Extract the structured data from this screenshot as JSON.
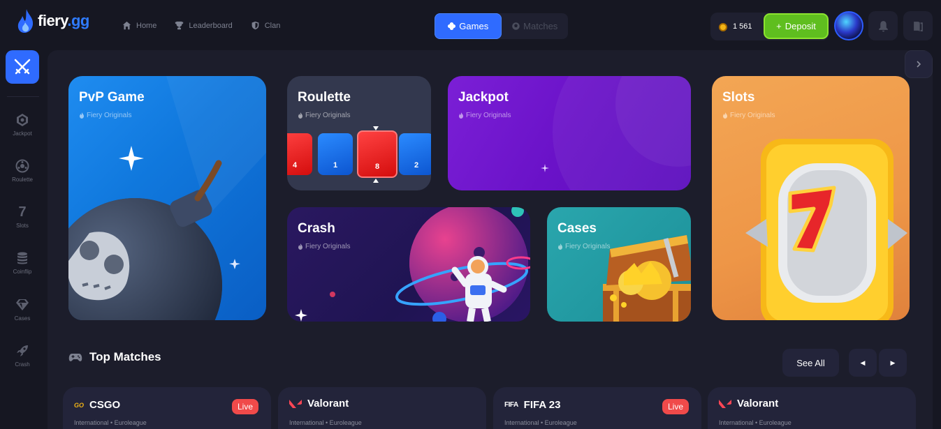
{
  "brand": {
    "name": "fiery",
    "tld": ".gg"
  },
  "nav": [
    {
      "label": "Home",
      "icon": "home-icon"
    },
    {
      "label": "Leaderboard",
      "icon": "trophy-icon"
    },
    {
      "label": "Clan",
      "icon": "shield-icon"
    }
  ],
  "switcher": {
    "games": "Games",
    "matches": "Matches",
    "active": "games"
  },
  "balance": {
    "value": "1 561",
    "currency_icon": "coin-icon"
  },
  "deposit_label": "Deposit",
  "colors": {
    "accent": "#2f6bff",
    "deposit": "#5fbe1f",
    "live": "#f04a4a"
  },
  "sidebar": [
    {
      "label": "Jackpot",
      "icon": "jackpot-icon"
    },
    {
      "label": "Roulette",
      "icon": "roulette-icon"
    },
    {
      "label": "Slots",
      "icon": "seven-icon"
    },
    {
      "label": "Coinflip",
      "icon": "coins-icon"
    },
    {
      "label": "Cases",
      "icon": "diamond-icon"
    },
    {
      "label": "Crash",
      "icon": "rocket-icon"
    }
  ],
  "games": {
    "pvp": {
      "title": "PvP Game",
      "subtitle": "Fiery Originals"
    },
    "roulette": {
      "title": "Roulette",
      "subtitle": "Fiery Originals",
      "tiles": [
        "4",
        "1",
        "8",
        "2"
      ]
    },
    "jackpot": {
      "title": "Jackpot",
      "subtitle": "Fiery Originals"
    },
    "slots": {
      "title": "Slots",
      "subtitle": "Fiery Originals"
    },
    "crash": {
      "title": "Crash",
      "subtitle": "Fiery Originals"
    },
    "cases": {
      "title": "Cases",
      "subtitle": "Fiery Originals"
    }
  },
  "top_matches": {
    "title": "Top Matches",
    "see_all": "See All",
    "items": [
      {
        "game": "CSGO",
        "logo": "GO",
        "meta": "International • Euroleague",
        "live": "Live"
      },
      {
        "game": "Valorant",
        "logo": "valorant-icon",
        "meta": "International • Euroleague",
        "live": ""
      },
      {
        "game": "FIFA 23",
        "logo": "FIFA",
        "meta": "International • Euroleague",
        "live": "Live"
      },
      {
        "game": "Valorant",
        "logo": "valorant-icon",
        "meta": "International • Euroleague",
        "live": ""
      }
    ]
  }
}
